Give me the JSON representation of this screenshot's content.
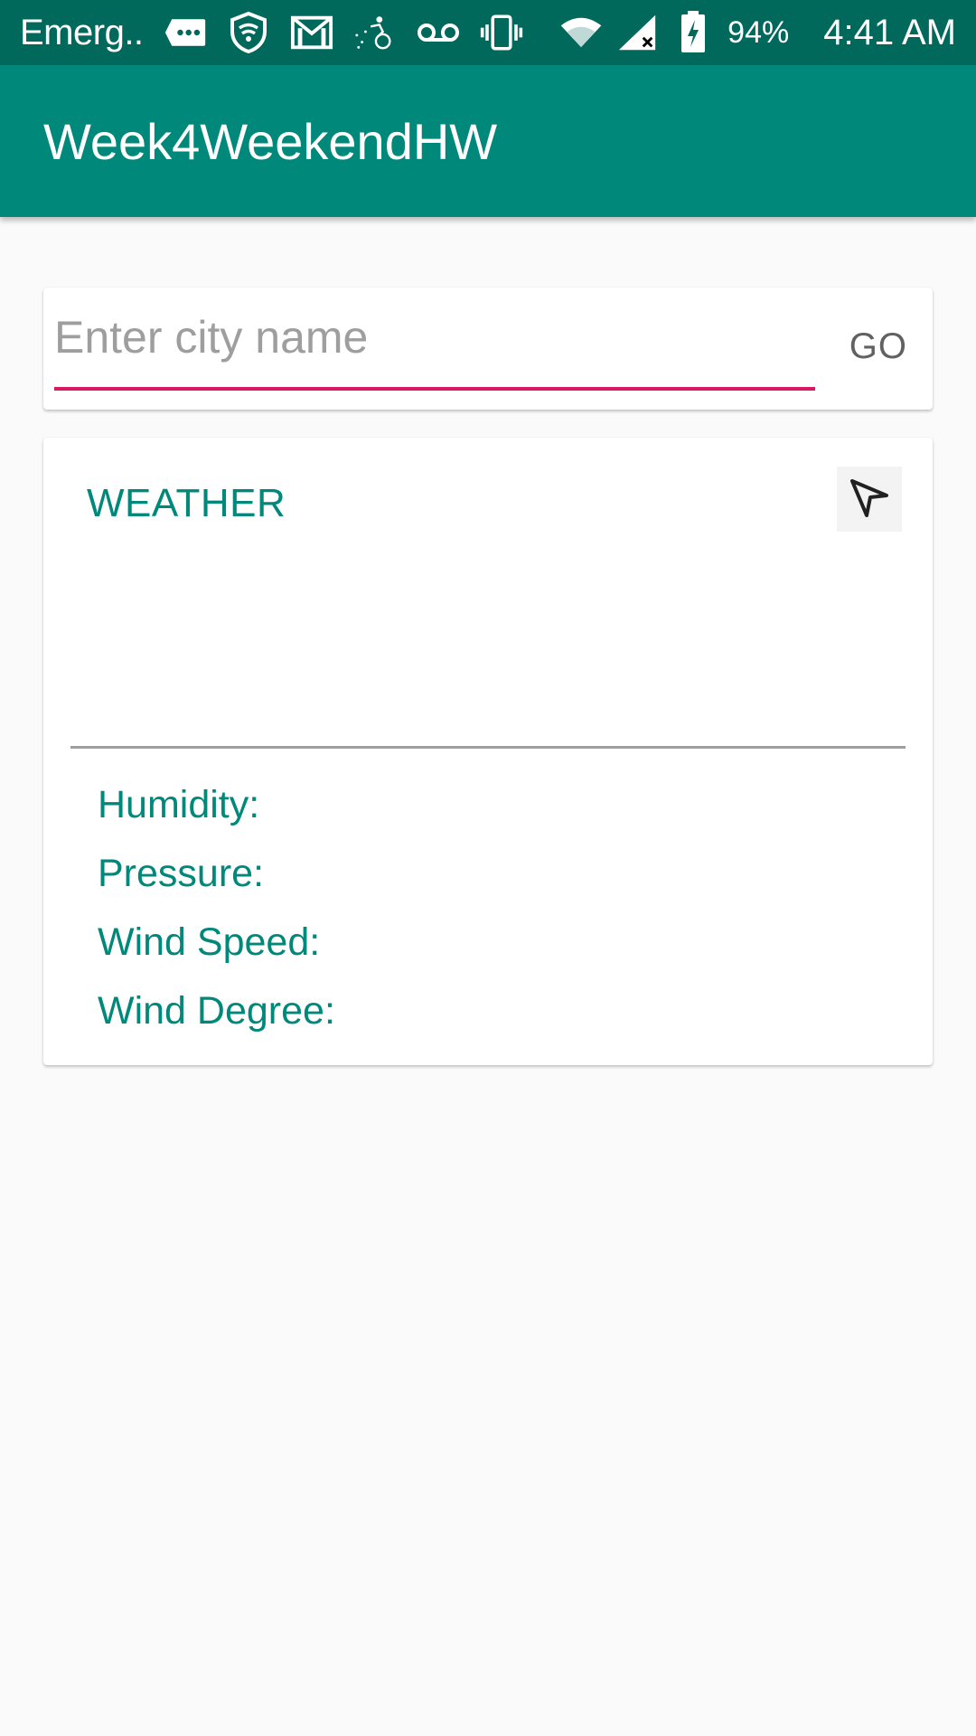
{
  "status_bar": {
    "carrier": "Emerg..",
    "battery_percent": "94%",
    "time": "4:41 AM",
    "icons": [
      "message-icon",
      "shield-icon",
      "gmail-icon",
      "bike-icon",
      "voicemail-icon",
      "vibrate-icon",
      "wifi-icon",
      "signal-icon",
      "battery-charging-icon"
    ]
  },
  "app_bar": {
    "title": "Week4WeekendHW"
  },
  "search": {
    "placeholder": "Enter city name",
    "value": "",
    "go_label": "GO"
  },
  "weather": {
    "title": "WEATHER",
    "location_icon": "navigation-arrow-icon",
    "humidity_label": "Humidity:",
    "pressure_label": "Pressure:",
    "wind_speed_label": "Wind Speed:",
    "wind_degree_label": "Wind Degree:"
  },
  "colors": {
    "status_bar": "#00695c",
    "app_bar": "#00897b",
    "accent": "#d81b60",
    "teal_text": "#00897b",
    "background": "#fafafa"
  }
}
